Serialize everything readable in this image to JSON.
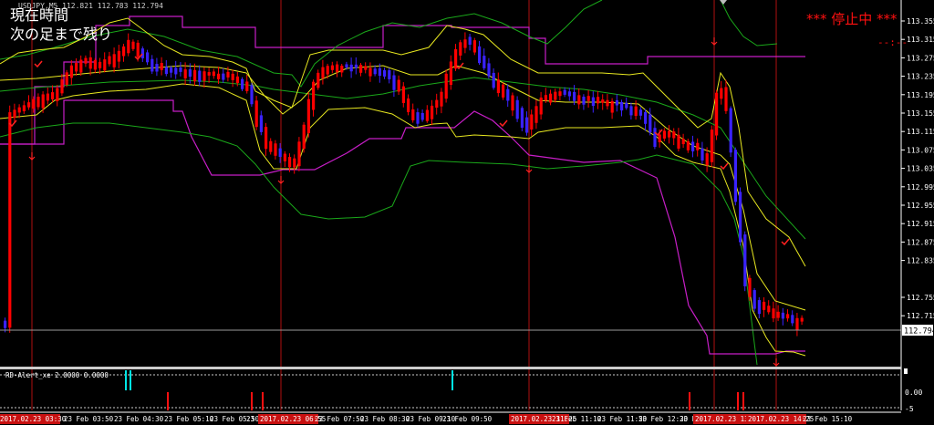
{
  "header": {
    "symbol_info": "USDJPY,M5  112.821 112.783 112.794",
    "current_time_label": "現在時間",
    "remaining_label": "次の足まで残り",
    "status_text": "*** 停止中 ***",
    "timer_text": "--:--"
  },
  "chart_data": {
    "type": "candlestick",
    "y_range": [
      112.72,
      113.38
    ],
    "y_ticks": [
      "113.355",
      "113.315",
      "113.275",
      "113.235",
      "113.195",
      "113.155",
      "113.115",
      "113.075",
      "113.035",
      "112.995",
      "112.955",
      "112.915",
      "112.875",
      "112.835",
      "112.794",
      "112.755",
      "112.715"
    ],
    "current_price": "112.794",
    "x_labels": [
      {
        "text": "23 Feb 03:50",
        "highlight": false
      },
      {
        "text": "23 Feb 04:30",
        "highlight": false
      },
      {
        "text": "23 Feb 05:10",
        "highlight": false
      },
      {
        "text": "23 Feb 05:50",
        "highlight": false
      },
      {
        "text": "23 Feb 06:30",
        "highlight": false
      },
      {
        "text": "2017.02.23 06:55",
        "highlight": true
      },
      {
        "text": "23 Feb 07:50",
        "highlight": false
      },
      {
        "text": "23 Feb 08:30",
        "highlight": false
      },
      {
        "text": "23 Feb 09:10",
        "highlight": false
      },
      {
        "text": "23 Feb 09:50",
        "highlight": false
      },
      {
        "text": "2017.02.23 11:25",
        "highlight": true
      },
      {
        "text": "23 Feb 11:10",
        "highlight": false
      },
      {
        "text": "23 Feb 11:50",
        "highlight": false
      },
      {
        "text": "23 Feb 12:30",
        "highlight": false
      },
      {
        "text": "23 Feb 13:10",
        "highlight": false
      },
      {
        "text": "2017.02.23 13:55",
        "highlight": true
      },
      {
        "text": "2017.02.23 14:25",
        "highlight": true
      },
      {
        "text": "23 Feb 15:10",
        "highlight": false
      }
    ],
    "first_label": "2017.02.23 03:30",
    "sub_window": {
      "label": "RD-Alert_xe  2.0000 0.0000",
      "ticks": [
        "0.00",
        "-5"
      ]
    }
  },
  "colors": {
    "bull": "#ff0000",
    "bear": "#3a22ff",
    "yellow_band": "#e8e820",
    "green_band": "#1aa81a",
    "magenta_channel": "#c71ec7",
    "vline": "#b01010",
    "cyan_signal": "#00e5e5"
  }
}
